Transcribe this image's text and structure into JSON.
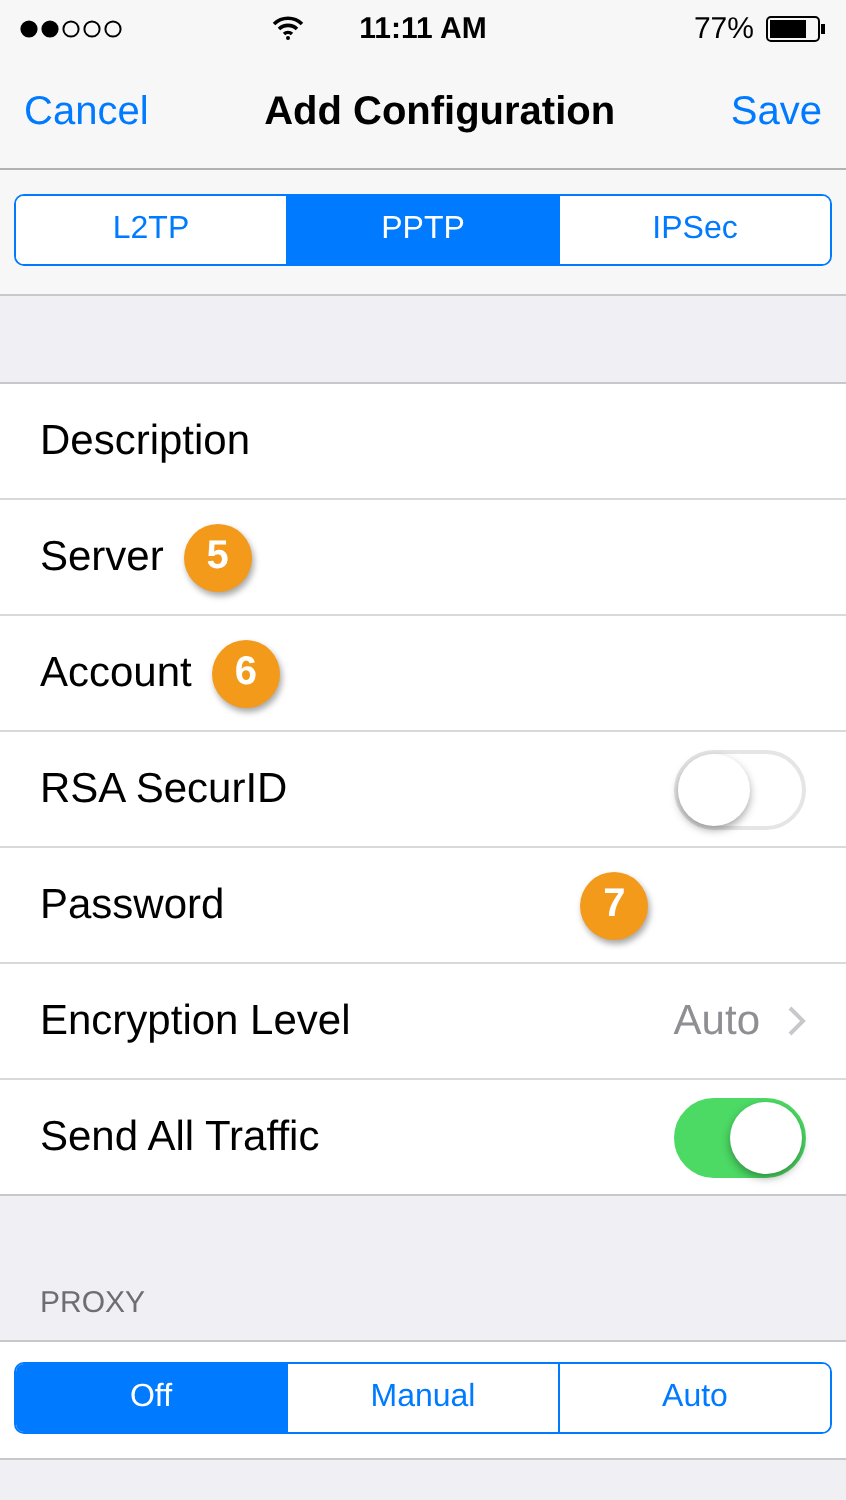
{
  "status_bar": {
    "time": "11:11 AM",
    "battery": "77%"
  },
  "nav": {
    "cancel": "Cancel",
    "title": "Add Configuration",
    "save": "Save"
  },
  "type_tabs": [
    {
      "label": "L2TP",
      "selected": false
    },
    {
      "label": "PPTP",
      "selected": true
    },
    {
      "label": "IPSec",
      "selected": false
    }
  ],
  "rows": [
    {
      "kind": "field",
      "label": "Description"
    },
    {
      "kind": "field",
      "label": "Server",
      "badge": {
        "kind": "inline",
        "text": "5"
      }
    },
    {
      "kind": "field",
      "label": "Account",
      "badge": {
        "kind": "inline",
        "text": "6"
      }
    },
    {
      "kind": "toggle",
      "label": "RSA SecurID",
      "on": false
    },
    {
      "kind": "field",
      "label": "Password",
      "badge": {
        "kind": "detached",
        "text": "7"
      }
    },
    {
      "kind": "disclosure",
      "label": "Encryption Level",
      "value": "Auto"
    },
    {
      "kind": "toggle",
      "label": "Send All Traffic",
      "on": true
    }
  ],
  "proxy": {
    "header": "PROXY",
    "tabs": [
      {
        "label": "Off",
        "selected": true
      },
      {
        "label": "Manual",
        "selected": false
      },
      {
        "label": "Auto",
        "selected": false
      }
    ]
  }
}
